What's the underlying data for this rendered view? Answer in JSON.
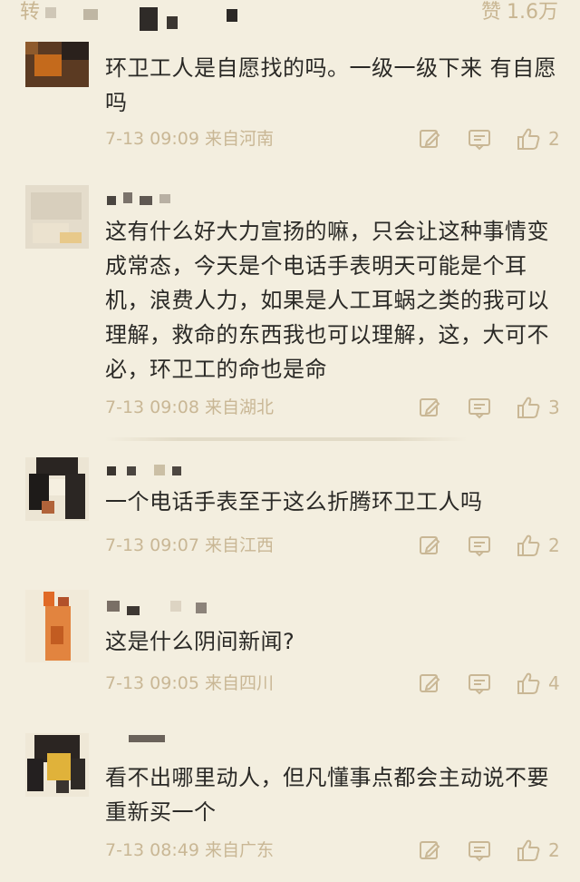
{
  "header": {
    "left_label": "转",
    "likes_label": "赞",
    "likes_count": "1.6万"
  },
  "comments": [
    {
      "text_line1": "环卫工人是自愿找的吗。一级一级下来 有自愿",
      "text_line2": "吗",
      "time": "7-13 09:09",
      "location": "来自河南",
      "likes": "2"
    },
    {
      "text_line1": "这有什么好大力宣扬的嘛，只会让这种事情变",
      "text_line2": "成常态，今天是个电话手表明天可能是个耳",
      "text_line3": "机，浪费人力，如果是人工耳蜗之类的我可以",
      "text_line4": "理解，救命的东西我也可以理解，这，大可不",
      "text_line5": "必，环卫工的命也是命",
      "time": "7-13 09:08",
      "location": "来自湖北",
      "likes": "3"
    },
    {
      "text_line1": "一个电话手表至于这么折腾环卫工人吗",
      "time": "7-13 09:07",
      "location": "来自江西",
      "likes": "2"
    },
    {
      "text_line1": "这是什么阴间新闻?",
      "time": "7-13 09:05",
      "location": "来自四川",
      "likes": "4"
    },
    {
      "text_line1": "看不出哪里动人，但凡懂事点都会主动说不要",
      "text_line2": "重新买一个",
      "time": "7-13 08:49",
      "location": "来自广东",
      "likes": "2"
    }
  ],
  "icons": {
    "edit": "edit-icon",
    "reply": "comment-icon",
    "like": "thumbs-up-icon"
  },
  "colors": {
    "background": "#f3eedf",
    "meta": "#c9b795",
    "text": "#2a2926"
  }
}
